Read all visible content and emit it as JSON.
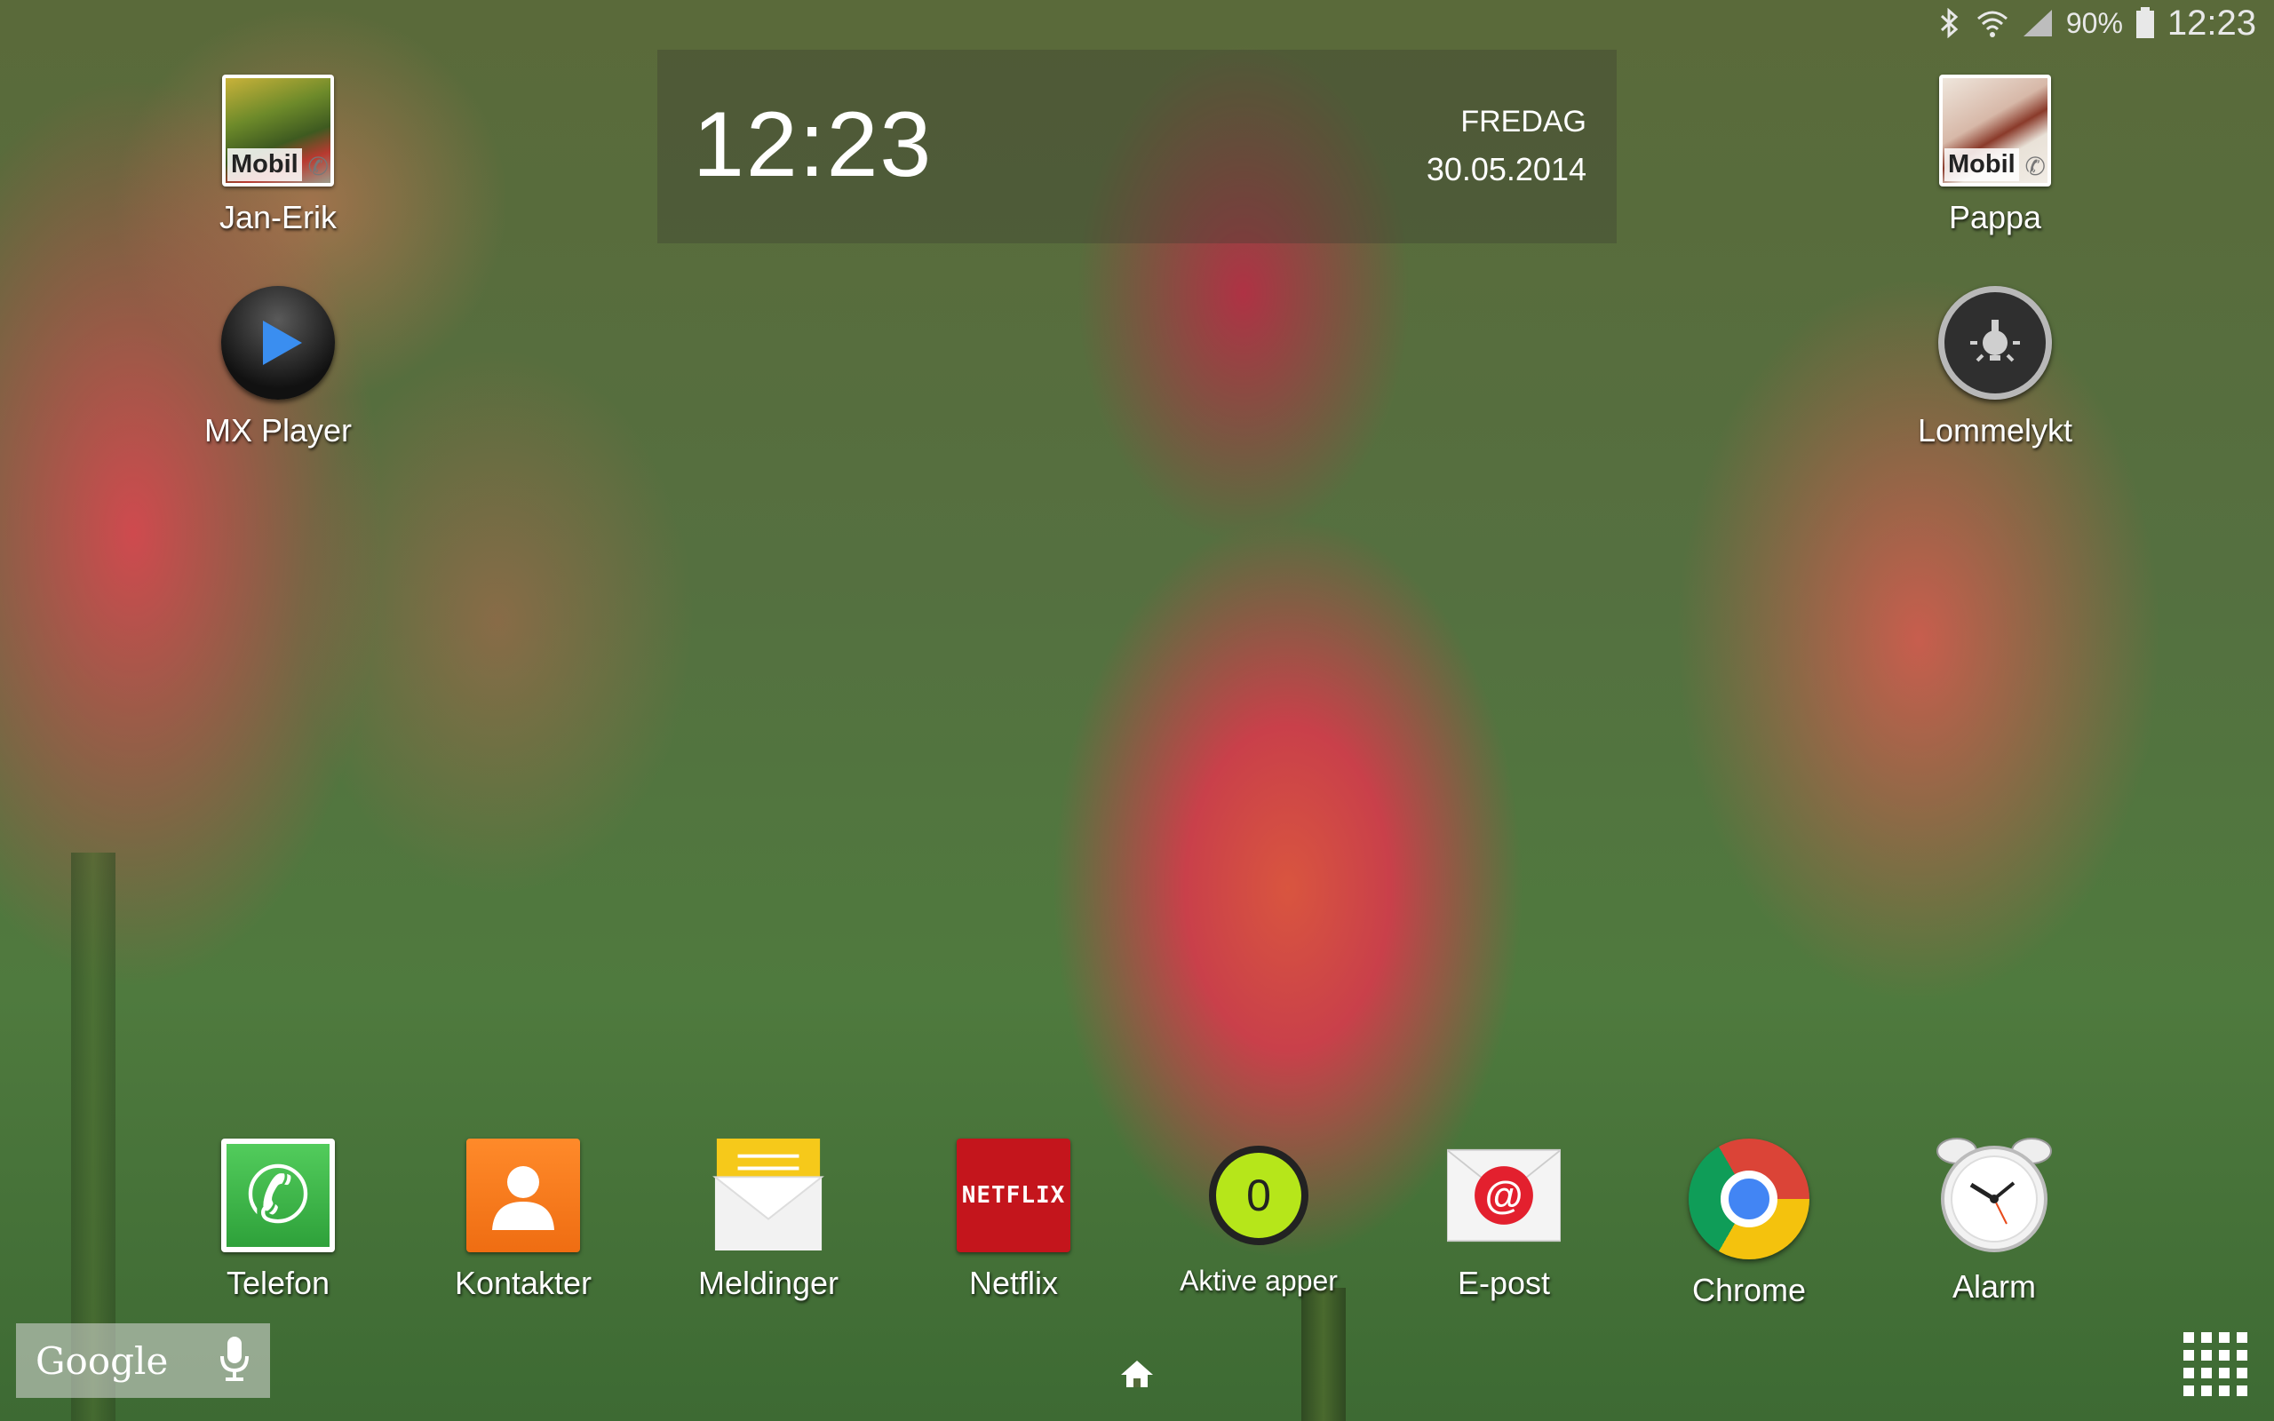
{
  "status_bar": {
    "icons": [
      "bluetooth-icon",
      "wifi-icon",
      "signal-icon",
      "battery-icon"
    ],
    "battery_percent": "90%",
    "time": "12:23"
  },
  "clock_widget": {
    "time": "12:23",
    "day": "FREDAG",
    "date": "30.05.2014"
  },
  "contacts": [
    {
      "name": "Jan-Erik",
      "badge": "Mobil"
    },
    {
      "name": "Pappa",
      "badge": "Mobil"
    }
  ],
  "apps": {
    "mx_player": "MX Player",
    "lommelykt": "Lommelykt"
  },
  "dock": [
    {
      "label": "Telefon",
      "icon": "phone-icon"
    },
    {
      "label": "Kontakter",
      "icon": "contacts-icon"
    },
    {
      "label": "Meldinger",
      "icon": "messages-icon"
    },
    {
      "label": "Netflix",
      "icon": "netflix-icon",
      "icon_text": "NETFLIX"
    },
    {
      "label": "Aktive apper",
      "icon": "active-apps-icon",
      "count": "0"
    },
    {
      "label": "E-post",
      "icon": "email-icon"
    },
    {
      "label": "Chrome",
      "icon": "chrome-icon"
    },
    {
      "label": "Alarm",
      "icon": "alarm-icon"
    }
  ],
  "search": {
    "logo": "Google",
    "mic_icon": "microphone-icon"
  },
  "nav": {
    "home_icon": "home-icon",
    "apps_icon": "apps-grid-icon"
  },
  "colors": {
    "phone_green": "#3db94a",
    "contacts_orange": "#f47a1f",
    "netflix_red": "#c4151c",
    "active_apps_green": "#b6e61a",
    "email_red": "#e3202e"
  }
}
